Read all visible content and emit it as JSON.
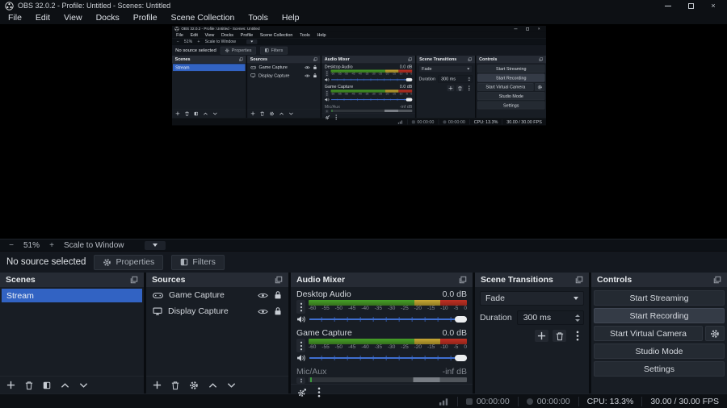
{
  "window": {
    "title": "OBS 32.0.2 - Profile: Untitled - Scenes: Untitled"
  },
  "menu": {
    "items": [
      "File",
      "Edit",
      "View",
      "Docks",
      "Profile",
      "Scene Collection",
      "Tools",
      "Help"
    ]
  },
  "preview": {
    "zoom_out": "−",
    "zoom_level": "51%",
    "zoom_in": "+",
    "scale_mode": "Scale to Window"
  },
  "source_bar": {
    "status": "No source selected",
    "properties": "Properties",
    "filters": "Filters"
  },
  "scenes": {
    "title": "Scenes",
    "items": [
      {
        "name": "Stream",
        "selected": true
      }
    ]
  },
  "sources": {
    "title": "Sources",
    "items": [
      {
        "name": "Game Capture",
        "icon": "gamepad-icon"
      },
      {
        "name": "Display Capture",
        "icon": "monitor-icon"
      }
    ]
  },
  "mixer": {
    "title": "Audio Mixer",
    "ticks": [
      "-60",
      "-55",
      "-50",
      "-45",
      "-40",
      "-35",
      "-30",
      "-25",
      "-20",
      "-15",
      "-10",
      "-5",
      "0"
    ],
    "channels": [
      {
        "name": "Desktop Audio",
        "level": "0.0 dB",
        "state": "active"
      },
      {
        "name": "Game Capture",
        "level": "0.0 dB",
        "state": "active"
      },
      {
        "name": "Mic/Aux",
        "level": "-inf dB",
        "state": "inactive"
      }
    ]
  },
  "transitions": {
    "title": "Scene Transitions",
    "transition_value": "Fade",
    "duration_label": "Duration",
    "duration_value": "300 ms"
  },
  "controls": {
    "title": "Controls",
    "buttons": [
      "Start Streaming",
      "Start Recording",
      "Start Virtual Camera",
      "Studio Mode",
      "Settings"
    ]
  },
  "statusbar": {
    "stream_time": "00:00:00",
    "record_time": "00:00:00",
    "cpu": "CPU: 13.3%",
    "fps": "30.00 / 30.00 FPS"
  },
  "colors": {
    "selection_blue": "#3263c3",
    "meter_green": "#3d8b27",
    "meter_yellow": "#b3962d",
    "meter_red": "#b3281e",
    "slider_blue": "#3f6fd0"
  }
}
